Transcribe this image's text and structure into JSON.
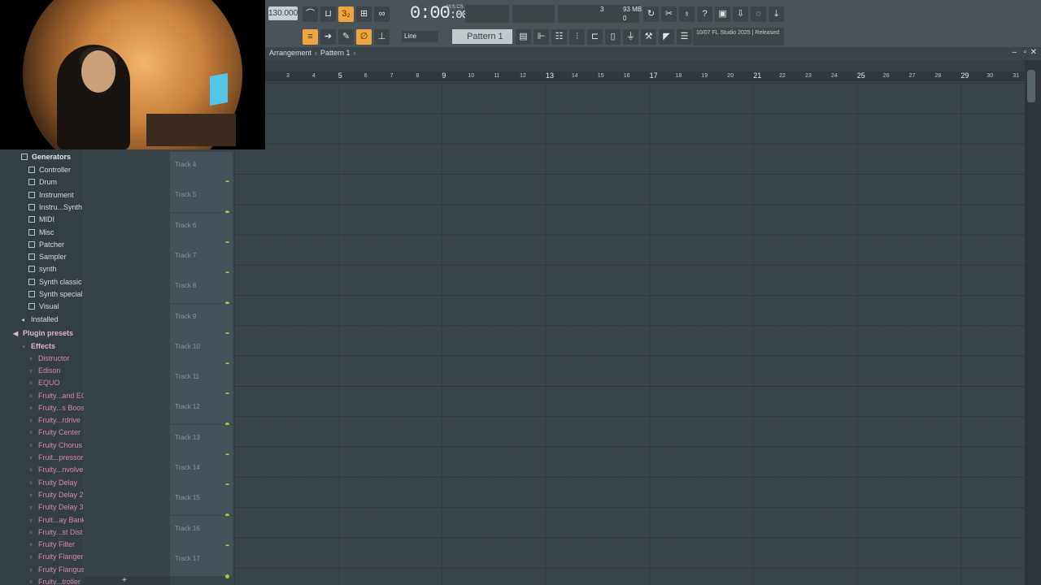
{
  "toolbar": {
    "tempo": "130.000",
    "time": "0:00",
    "time_frac": ":00",
    "time_unit": "M:S:CS",
    "cpu": "3",
    "memory": "93 MB",
    "polyphony": "0",
    "snap": "Line",
    "pattern": "Pattern 1",
    "news_date": "10/07",
    "news_text": "FL Studio 2025 | Released"
  },
  "window": {
    "crumb": [
      "Arrangement",
      "Pattern 1"
    ]
  },
  "browser": {
    "generators_header": "Generators",
    "generators": [
      "Controller",
      "Drum",
      "Instrument",
      "Instru...Synth",
      "MIDI",
      "Misc",
      "Patcher",
      "Sampler",
      "synth",
      "Synth classic",
      "Synth special",
      "Visual"
    ],
    "installed": "Installed",
    "plugin_presets": "Plugin presets",
    "effects_header": "Effects",
    "effects": [
      "Distructor",
      "Edison",
      "EQUO",
      "Fruity...and EQ",
      "Fruity...s Boost",
      "Fruity...rdrive",
      "Fruity Center",
      "Fruity Chorus",
      "Fruit...pressor",
      "Fruity...nvolver",
      "Fruity Delay",
      "Fruity Delay 2",
      "Fruity Delay 3",
      "Fruit...ay Bank",
      "Fruity...st Dist",
      "Fruity Filter",
      "Fruity Flanger",
      "Fruity Flangus",
      "Fruity...troller"
    ]
  },
  "tracks": [
    "Track 4",
    "Track 5",
    "Track 6",
    "Track 7",
    "Track 8",
    "Track 9",
    "Track 10",
    "Track 11",
    "Track 12",
    "Track 13",
    "Track 14",
    "Track 15",
    "Track 16",
    "Track 17"
  ],
  "ruler": [
    "3",
    "4",
    "5",
    "6",
    "7",
    "8",
    "9",
    "10",
    "11",
    "12",
    "13",
    "14",
    "15",
    "16",
    "17",
    "18",
    "19",
    "20",
    "21",
    "22",
    "23",
    "24",
    "25",
    "26",
    "27",
    "28",
    "29",
    "30",
    "31"
  ],
  "colors": {
    "accent": "#f0a640",
    "track_led": "#8fd33a",
    "plugin_text": "#d88aa6"
  }
}
